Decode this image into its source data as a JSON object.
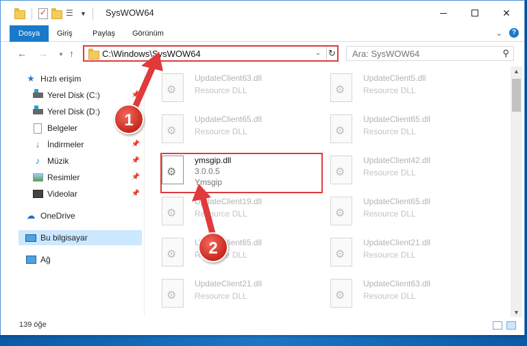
{
  "window": {
    "title": "SysWOW64"
  },
  "ribbon": {
    "tabs": [
      "Dosya",
      "Giriş",
      "Paylaş",
      "Görünüm"
    ]
  },
  "address": {
    "path": "C:\\Windows\\SysWOW64"
  },
  "search": {
    "placeholder": "Ara: SysWOW64"
  },
  "nav": {
    "quick_access": "Hızlı erişim",
    "items": [
      {
        "label": "Yerel Disk (C:)",
        "icon": "drive-icon",
        "pinned": true
      },
      {
        "label": "Yerel Disk (D:)",
        "icon": "drive-icon",
        "pinned": false
      },
      {
        "label": "Belgeler",
        "icon": "documents-icon",
        "pinned": true
      },
      {
        "label": "İndirmeler",
        "icon": "downloads-icon",
        "pinned": true
      },
      {
        "label": "Müzik",
        "icon": "music-icon",
        "pinned": true
      },
      {
        "label": "Resimler",
        "icon": "pictures-icon",
        "pinned": true
      },
      {
        "label": "Videolar",
        "icon": "videos-icon",
        "pinned": true
      }
    ],
    "onedrive": "OneDrive",
    "this_pc": "Bu bilgisayar",
    "network": "Ağ"
  },
  "files": [
    {
      "name": "UpdateClient63.dll",
      "desc": "Resource DLL"
    },
    {
      "name": "UpdateClient5.dll",
      "desc": "Resource DLL"
    },
    {
      "name": "UpdateClient65.dll",
      "desc": "Resource DLL"
    },
    {
      "name": "UpdateClient65.dll",
      "desc": "Resource DLL"
    },
    {
      "name": "ymsgip.dll",
      "version": "3.0.0.5",
      "product": "Ymsgip"
    },
    {
      "name": "UpdateClient42.dll",
      "desc": "Resource DLL"
    },
    {
      "name": "UpdateClient19.dll",
      "desc": "Resource DLL"
    },
    {
      "name": "UpdateClient65.dll",
      "desc": "Resource DLL"
    },
    {
      "name": "UpdateClient65.dll",
      "desc": "Resource DLL"
    },
    {
      "name": "UpdateClient21.dll",
      "desc": "Resource DLL"
    },
    {
      "name": "UpdateClient21.dll",
      "desc": "Resource DLL"
    },
    {
      "name": "UpdateClient63.dll",
      "desc": "Resource DLL"
    }
  ],
  "status": {
    "count": "139 öğe"
  },
  "callouts": [
    "1",
    "2"
  ],
  "colors": {
    "accent": "#1979ca",
    "highlight": "#e03a3a",
    "selected": "#cce8ff"
  }
}
